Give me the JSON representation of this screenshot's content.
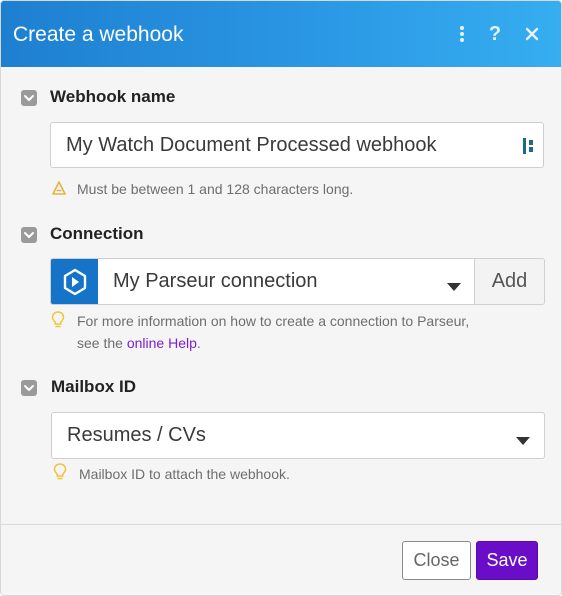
{
  "dialog": {
    "title": "Create a webhook",
    "header_icons": [
      "more-vertical-icon",
      "help-icon",
      "close-icon"
    ]
  },
  "webhook_name": {
    "label": "Webhook name",
    "value": "My Watch Document Processed webhook",
    "hint": "Must be between 1 and 128 characters long."
  },
  "connection": {
    "label": "Connection",
    "selected": "My Parseur connection",
    "add_label": "Add",
    "hint_prefix": "For more information on how to create a connection to Parseur,",
    "hint_see": "see the",
    "hint_link": "online Help",
    "hint_suffix": "."
  },
  "mailbox": {
    "label": "Mailbox ID",
    "selected": "Resumes / CVs",
    "hint": "Mailbox ID to attach the webhook."
  },
  "footer": {
    "close_label": "Close",
    "save_label": "Save"
  },
  "colors": {
    "header_start": "#1e7fd0",
    "header_end": "#36aef0",
    "save_button": "#6a0dc8",
    "link": "#7a1fd0",
    "parseur_brand": "#1573c8",
    "warning_icon": "#e3b341",
    "tip_icon": "#f0c43c"
  }
}
